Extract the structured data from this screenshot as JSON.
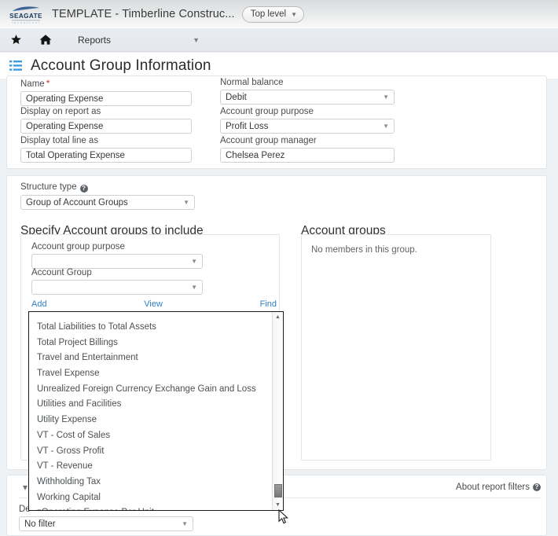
{
  "brand": {
    "logo_name": "seagate-logo",
    "logo_text": "SEAGATE",
    "title": "TEMPLATE - Timberline Construc...",
    "scope_pill": "Top level"
  },
  "nav": {
    "favorite_icon": "star-icon",
    "home_icon": "home-icon",
    "menu_label": "Reports"
  },
  "page": {
    "list_icon": "list-icon",
    "title": "Account Group Information"
  },
  "top_card": {
    "left_fields": [
      {
        "label": "Name",
        "required": true,
        "value": "Operating Expense",
        "type": "text"
      },
      {
        "label": "Display on report as",
        "required": false,
        "value": "Operating Expense",
        "type": "text"
      },
      {
        "label": "Display total line as",
        "required": false,
        "value": "Total Operating Expense",
        "type": "text"
      }
    ],
    "right_fields": [
      {
        "label": "Normal balance",
        "required": false,
        "value": "Debit",
        "type": "select"
      },
      {
        "label": "Account group purpose",
        "required": false,
        "value": "Profit Loss",
        "type": "select"
      },
      {
        "label": "Account group manager",
        "required": false,
        "value": "Chelsea Perez",
        "type": "text"
      }
    ]
  },
  "structure": {
    "label": "Structure type",
    "help_icon": "help-icon",
    "value": "Group of Account Groups"
  },
  "specify": {
    "heading": "Specify Account groups to include",
    "purpose_label": "Account group purpose",
    "purpose_value": "",
    "group_label": "Account Group",
    "group_value": "",
    "actions": {
      "add": "Add",
      "view": "View",
      "find": "Find"
    }
  },
  "dropdown": {
    "open": true,
    "items": [
      "Total Liabilities to Total Assets",
      "Total Project Billings",
      "Travel and Entertainment",
      "Travel Expense",
      "Unrealized Foreign Currency Exchange Gain and Loss",
      "Utilities and Facilities",
      "Utility Expense",
      "VT - Cost of Sales",
      "VT - Gross Profit",
      "VT - Revenue",
      "Withholding Tax",
      "Working Capital",
      "zOperating Expense Per Unit"
    ],
    "scroll_up_icon": "scroll-up-arrow-icon",
    "scroll_down_icon": "scroll-down-arrow-icon"
  },
  "account_groups": {
    "heading": "Account groups",
    "empty_message": "No members in this group."
  },
  "bottom": {
    "collapse_icon": "chevron-down-icon",
    "about_label": "About report filters",
    "about_help_icon": "help-icon",
    "filter_label": "De",
    "filter_value": "No filter"
  },
  "colors": {
    "link": "#2e7fc4",
    "accent_icon": "#3d9be0",
    "required": "#d0342c",
    "page_bg": "#eef1f4"
  }
}
